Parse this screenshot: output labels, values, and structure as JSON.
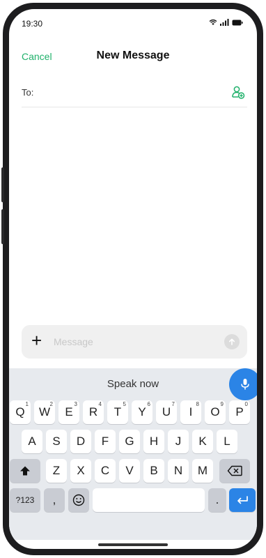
{
  "status_bar": {
    "time": "19:30"
  },
  "header": {
    "cancel_label": "Cancel",
    "title": "New Message"
  },
  "recipient": {
    "to_label": "To:",
    "add_contact_icon": "person-add-icon"
  },
  "composer": {
    "add_icon": "+",
    "placeholder": "Message",
    "send_icon": "send-arrow-icon"
  },
  "keyboard": {
    "speak_label": "Speak now",
    "row1": [
      {
        "k": "Q",
        "h": "1"
      },
      {
        "k": "W",
        "h": "2"
      },
      {
        "k": "E",
        "h": "3"
      },
      {
        "k": "R",
        "h": "4"
      },
      {
        "k": "T",
        "h": "5"
      },
      {
        "k": "Y",
        "h": "6"
      },
      {
        "k": "U",
        "h": "7"
      },
      {
        "k": "I",
        "h": "8"
      },
      {
        "k": "O",
        "h": "9"
      },
      {
        "k": "P",
        "h": "0"
      }
    ],
    "row2": [
      "A",
      "S",
      "D",
      "F",
      "G",
      "H",
      "J",
      "K",
      "L"
    ],
    "row3": [
      "Z",
      "X",
      "C",
      "V",
      "B",
      "N",
      "M"
    ],
    "sym_label": "?123",
    "comma_label": ",",
    "period_label": "."
  },
  "colors": {
    "accent_green": "#20b16b",
    "keyboard_blue": "#2b84e6"
  }
}
